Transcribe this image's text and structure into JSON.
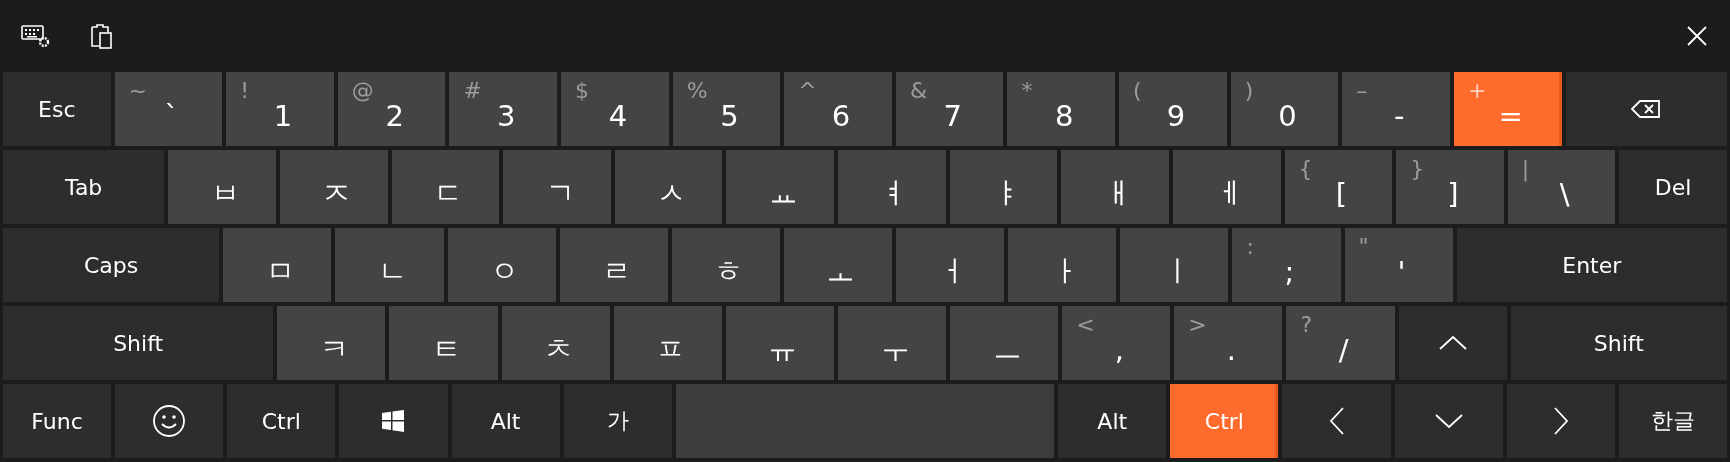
{
  "rows": [
    {
      "keys": [
        {
          "kind": "mod",
          "label": "Esc",
          "pressed": false
        },
        {
          "kind": "char",
          "shift": "~",
          "label": "`",
          "pressed": false
        },
        {
          "kind": "char",
          "shift": "!",
          "label": "1",
          "pressed": false
        },
        {
          "kind": "char",
          "shift": "@",
          "label": "2",
          "pressed": false
        },
        {
          "kind": "char",
          "shift": "#",
          "label": "3",
          "pressed": false
        },
        {
          "kind": "char",
          "shift": "$",
          "label": "4",
          "pressed": false
        },
        {
          "kind": "char",
          "shift": "%",
          "label": "5",
          "pressed": false
        },
        {
          "kind": "char",
          "shift": "^",
          "label": "6",
          "pressed": false
        },
        {
          "kind": "char",
          "shift": "&",
          "label": "7",
          "pressed": false
        },
        {
          "kind": "char",
          "shift": "*",
          "label": "8",
          "pressed": false
        },
        {
          "kind": "char",
          "shift": "(",
          "label": "9",
          "pressed": false
        },
        {
          "kind": "char",
          "shift": ")",
          "label": "0",
          "pressed": false
        },
        {
          "kind": "char",
          "shift": "–",
          "label": "-",
          "pressed": false
        },
        {
          "kind": "char",
          "shift": "+",
          "label": "=",
          "pressed": true
        },
        {
          "kind": "backspace",
          "pressed": false
        }
      ]
    },
    {
      "keys": [
        {
          "kind": "mod",
          "label": "Tab",
          "pressed": false
        },
        {
          "kind": "char",
          "label": "ㅂ",
          "pressed": false
        },
        {
          "kind": "char",
          "label": "ㅈ",
          "pressed": false
        },
        {
          "kind": "char",
          "label": "ㄷ",
          "pressed": false
        },
        {
          "kind": "char",
          "label": "ㄱ",
          "pressed": false
        },
        {
          "kind": "char",
          "label": "ㅅ",
          "pressed": false
        },
        {
          "kind": "char",
          "label": "ㅛ",
          "pressed": false
        },
        {
          "kind": "char",
          "label": "ㅕ",
          "pressed": false
        },
        {
          "kind": "char",
          "label": "ㅑ",
          "pressed": false
        },
        {
          "kind": "char",
          "label": "ㅐ",
          "pressed": false
        },
        {
          "kind": "char",
          "label": "ㅔ",
          "pressed": false
        },
        {
          "kind": "char",
          "shift": "{",
          "label": "[",
          "pressed": false
        },
        {
          "kind": "char",
          "shift": "}",
          "label": "]",
          "pressed": false
        },
        {
          "kind": "char",
          "shift": "|",
          "label": "\\",
          "pressed": false
        },
        {
          "kind": "mod",
          "label": "Del",
          "pressed": false
        }
      ]
    },
    {
      "keys": [
        {
          "kind": "mod",
          "label": "Caps",
          "pressed": false
        },
        {
          "kind": "char",
          "label": "ㅁ",
          "pressed": false
        },
        {
          "kind": "char",
          "label": "ㄴ",
          "pressed": false
        },
        {
          "kind": "char",
          "label": "ㅇ",
          "pressed": false
        },
        {
          "kind": "char",
          "label": "ㄹ",
          "pressed": false
        },
        {
          "kind": "char",
          "label": "ㅎ",
          "pressed": false
        },
        {
          "kind": "char",
          "label": "ㅗ",
          "pressed": false
        },
        {
          "kind": "char",
          "label": "ㅓ",
          "pressed": false
        },
        {
          "kind": "char",
          "label": "ㅏ",
          "pressed": false
        },
        {
          "kind": "char",
          "label": "ㅣ",
          "pressed": false
        },
        {
          "kind": "char",
          "shift": ":",
          "label": ";",
          "pressed": false
        },
        {
          "kind": "char",
          "shift": "\"",
          "label": "'",
          "pressed": false
        },
        {
          "kind": "mod",
          "label": "Enter",
          "pressed": false
        }
      ]
    },
    {
      "keys": [
        {
          "kind": "mod",
          "label": "Shift",
          "pressed": false
        },
        {
          "kind": "char",
          "label": "ㅋ",
          "pressed": false
        },
        {
          "kind": "char",
          "label": "ㅌ",
          "pressed": false
        },
        {
          "kind": "char",
          "label": "ㅊ",
          "pressed": false
        },
        {
          "kind": "char",
          "label": "ㅍ",
          "pressed": false
        },
        {
          "kind": "char",
          "label": "ㅠ",
          "pressed": false
        },
        {
          "kind": "char",
          "label": "ㅜ",
          "pressed": false
        },
        {
          "kind": "char",
          "label": "ㅡ",
          "pressed": false
        },
        {
          "kind": "char",
          "shift": "<",
          "label": ",",
          "pressed": false
        },
        {
          "kind": "char",
          "shift": ">",
          "label": ".",
          "pressed": false
        },
        {
          "kind": "char",
          "shift": "?",
          "label": "/",
          "pressed": false
        },
        {
          "kind": "up",
          "pressed": false
        },
        {
          "kind": "mod",
          "label": "Shift",
          "pressed": false
        }
      ]
    },
    {
      "keys": [
        {
          "kind": "mod",
          "label": "Func",
          "pressed": false
        },
        {
          "kind": "emoji",
          "pressed": false
        },
        {
          "kind": "mod",
          "label": "Ctrl",
          "pressed": false
        },
        {
          "kind": "windows",
          "pressed": false
        },
        {
          "kind": "mod",
          "label": "Alt",
          "pressed": false
        },
        {
          "kind": "mod",
          "label": "가",
          "pressed": false
        },
        {
          "kind": "space",
          "pressed": false
        },
        {
          "kind": "mod",
          "label": "Alt",
          "pressed": false
        },
        {
          "kind": "mod",
          "label": "Ctrl",
          "pressed": true
        },
        {
          "kind": "left",
          "pressed": false
        },
        {
          "kind": "down",
          "pressed": false
        },
        {
          "kind": "right",
          "pressed": false
        },
        {
          "kind": "mod",
          "label": "한글",
          "pressed": false
        }
      ]
    }
  ]
}
